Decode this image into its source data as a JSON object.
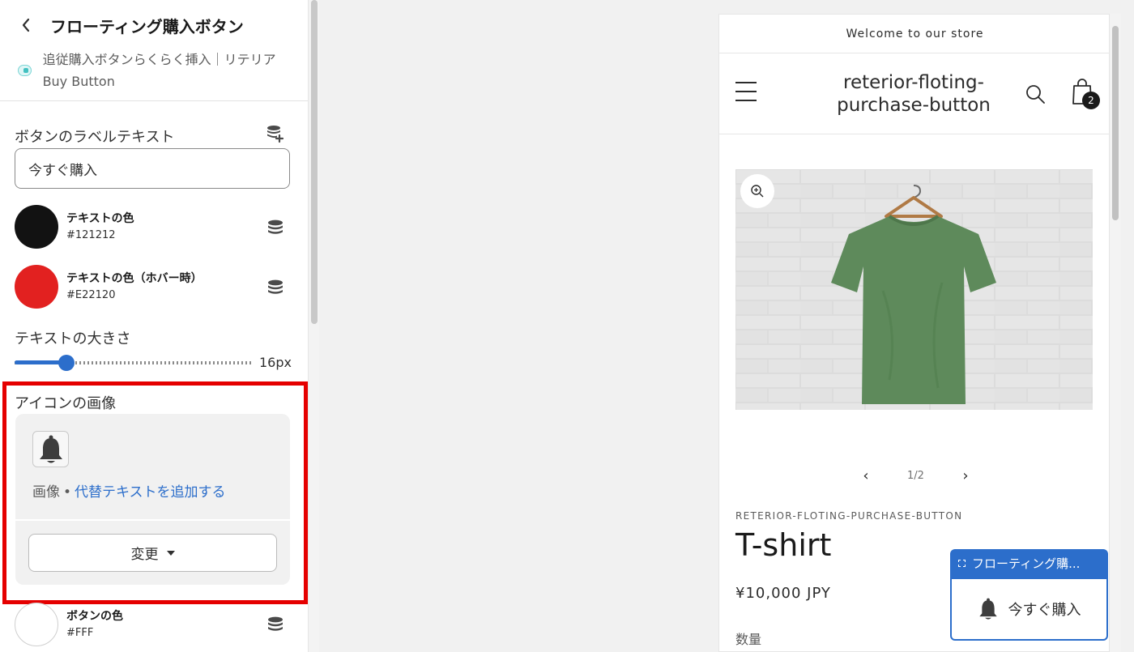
{
  "panel": {
    "title": "フローティング購入ボタン",
    "app_name": "追従購入ボタンらくらく挿入｜リテリア Buy Button",
    "label_text": {
      "label": "ボタンのラベルテキスト",
      "value": "今すぐ購入"
    },
    "text_color": {
      "name": "テキストの色",
      "hex": "#121212",
      "swatch": "#121212"
    },
    "text_hover_color": {
      "name": "テキストの色（ホバー時）",
      "hex": "#E22120",
      "swatch": "#E22120"
    },
    "text_size": {
      "label": "テキストの大きさ",
      "value": "16px",
      "fraction": 0.22
    },
    "icon_image": {
      "label": "アイコンの画像",
      "type_text": "画像",
      "separator": "•",
      "alt_link": "代替テキストを追加する",
      "change_button": "変更"
    },
    "button_color": {
      "name": "ボタンの色",
      "hex": "#FFF",
      "swatch": "#FFFFFF"
    },
    "icons": {
      "back": "chevron-left-icon",
      "dynamic_source_add": "database-add-icon",
      "dynamic_source": "database-icon"
    }
  },
  "preview": {
    "announcement": "Welcome to our store",
    "store_name": "reterior-floting-purchase-button",
    "cart_count": "2",
    "pager": {
      "count": "1/2"
    },
    "vendor": "RETERIOR-FLOTING-PURCHASE-BUTTON",
    "product_title": "T-shirt",
    "price": "¥10,000 JPY",
    "quantity_label": "数量",
    "floating": {
      "tag": "フローティング購...",
      "button_label": "今すぐ購入"
    }
  },
  "colors": {
    "accent": "#2c6ecb",
    "highlight": "#e50000",
    "shirt": "#5e8a5b"
  }
}
